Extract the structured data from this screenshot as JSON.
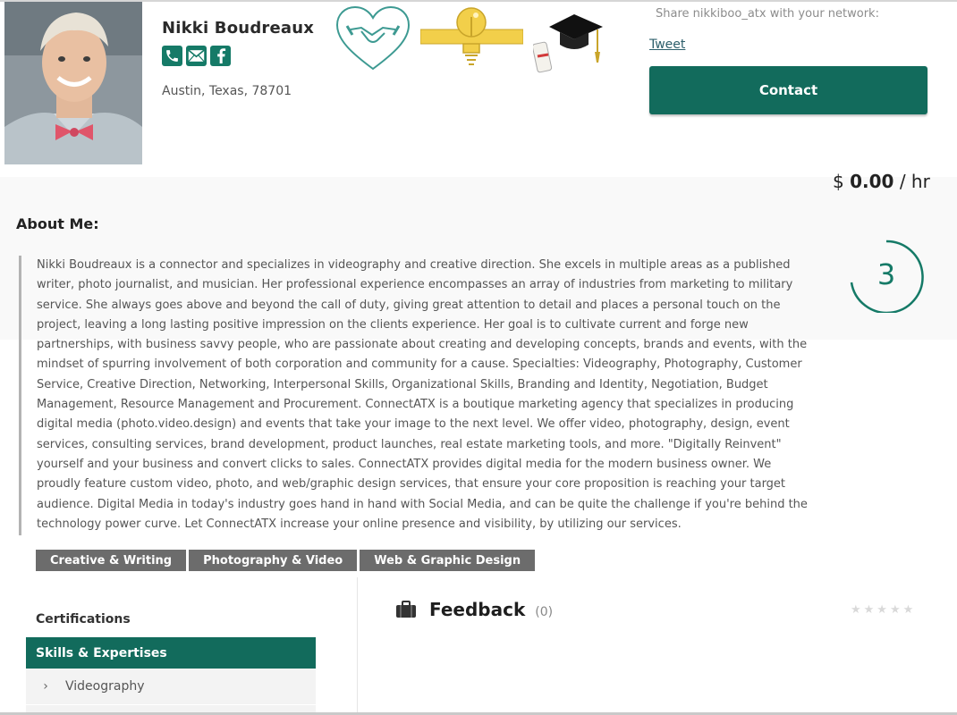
{
  "profile": {
    "name": "Nikki Boudreaux",
    "location": "Austin, Texas, 78701",
    "rate_prefix": "$",
    "rate_value": "0.00",
    "rate_suffix": "/ hr",
    "contact_icons": [
      "phone-icon",
      "mail-icon",
      "facebook-icon"
    ],
    "badges": [
      "heart-handshake-badge",
      "lightbulb-badge",
      "graduation-badge"
    ]
  },
  "share": {
    "text": "Share nikkiboo_atx with your network:",
    "tweet_label": "Tweet",
    "contact_label": "Contact"
  },
  "about": {
    "title": "About Me:",
    "text": "Nikki Boudreaux is a connector and specializes in videography and creative direction. She excels in multiple areas as a published writer, photo journalist, and musician. Her professional experience encompasses an array of industries from marketing to military service. She always goes above and beyond the call of duty, giving great attention to detail and places a personal touch on the project, leaving a long lasting positive impression on the clients experience. Her goal is to cultivate current and forge new partnerships, with business savvy people, who are passionate about creating and developing concepts, brands and events, with the mindset of spurring involvement of both corporation and community for a cause. Specialties: Videography, Photography, Customer Service, Creative Direction, Networking, Interpersonal Skills, Organizational Skills, Branding and Identity, Negotiation, Budget Management, Resource Management and Procurement. ConnectATX is a boutique marketing agency that specializes in producing digital media (photo.video.design) and events that take your image to the next level. We offer video, photography, design, event services, consulting services, brand development, product launches, real estate marketing tools, and more. \"Digitally Reinvent\" yourself and your business and convert clicks to sales. ConnectATX provides digital media for the modern business owner. We proudly feature custom video, photo, and web/graphic design services, that ensure your core proposition is reaching your target audience. Digital Media in today's industry goes hand in hand with Social Media, and can be quite the challenge if you're behind the technology power curve. Let ConnectATX increase your online presence and visibility, by utilizing our services.",
    "count": "3"
  },
  "tags": [
    "Creative & Writing",
    "Photography & Video",
    "Web & Graphic Design"
  ],
  "sidebar": {
    "certifications_label": "Certifications",
    "skills_label": "Skills & Expertises",
    "skills": [
      "Videography"
    ]
  },
  "feedback": {
    "title": "Feedback",
    "count": "(0)",
    "rating_stars": "★★★★★"
  },
  "colors": {
    "accent": "#126b5c",
    "tag_bg": "#6c6c6c"
  }
}
